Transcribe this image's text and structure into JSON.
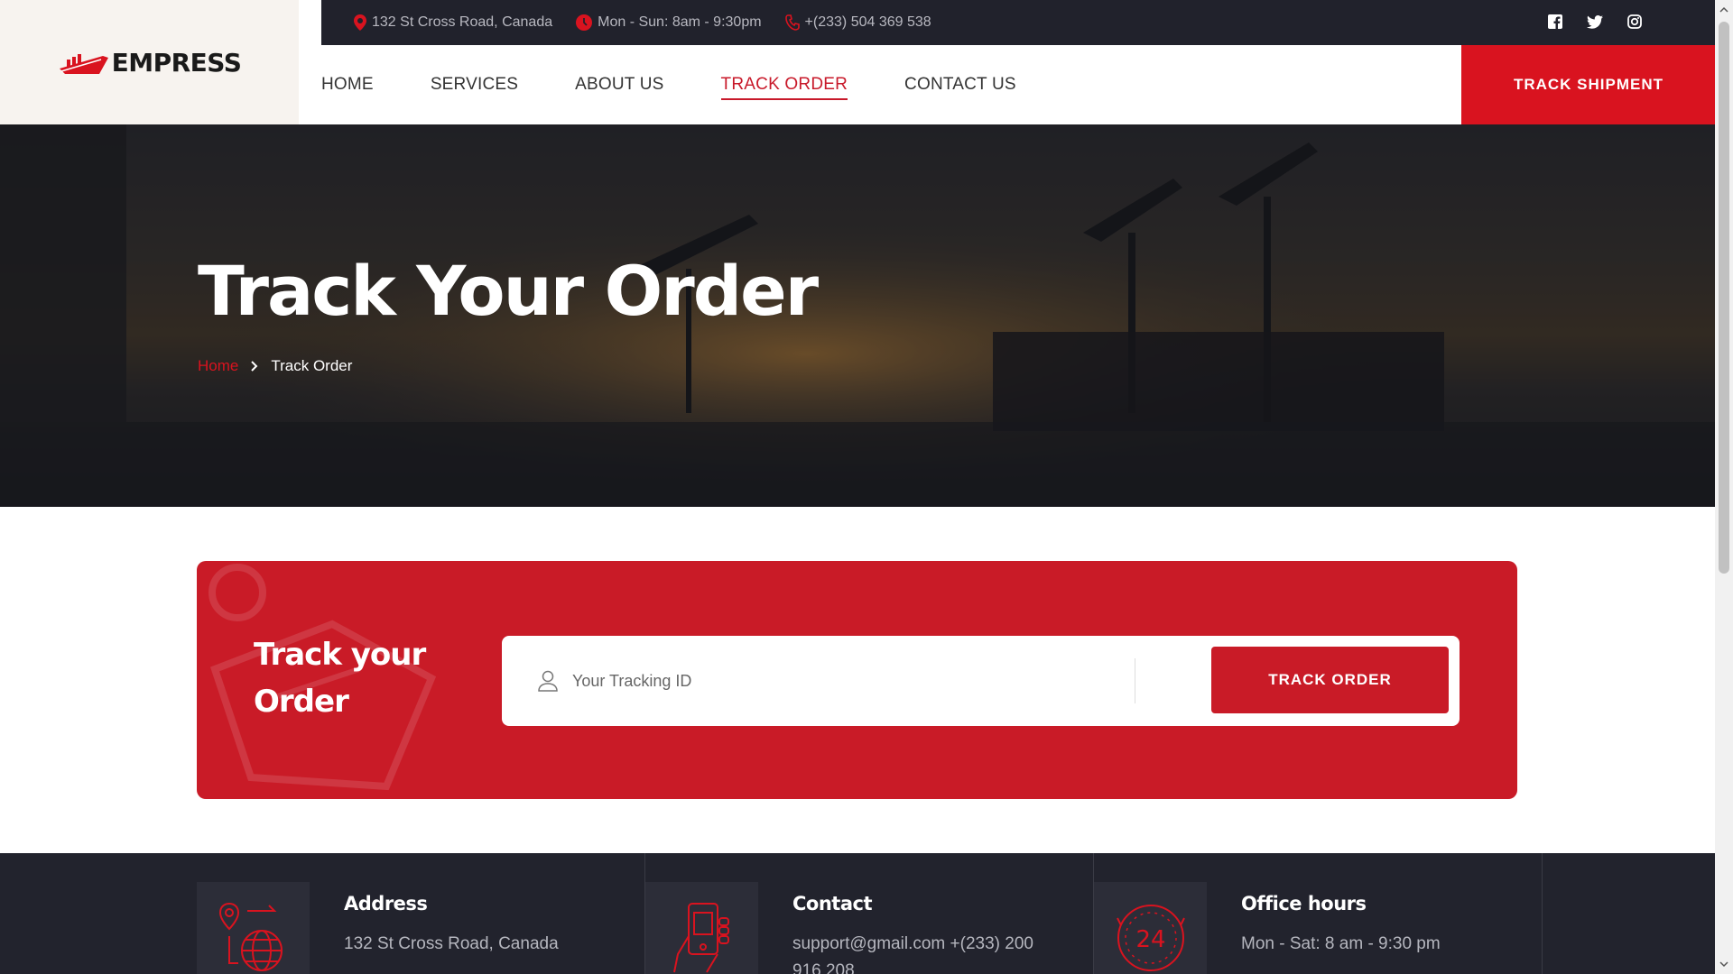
{
  "brand": {
    "name": "EMPRESS"
  },
  "topbar": {
    "address": "132 St Cross Road, Canada",
    "hours": "Mon - Sun: 8am - 9:30pm",
    "phone": "+(233) 504 369 538"
  },
  "nav": {
    "items": [
      "HOME",
      "SERVICES",
      "ABOUT US",
      "TRACK ORDER",
      "CONTACT US"
    ],
    "active": "TRACK ORDER",
    "cta_label": "TRACK SHIPMENT"
  },
  "hero": {
    "title": "Track Your Order",
    "breadcrumb_home": "Home",
    "breadcrumb_current": "Track Order"
  },
  "track_form": {
    "title": "Track your Order",
    "input_placeholder": "Your Tracking ID",
    "input_value": "",
    "button_label": "TRACK ORDER"
  },
  "info": [
    {
      "heading": "Address",
      "text": "132 St Cross Road, Canada",
      "icon": "location-globe-icon"
    },
    {
      "heading": "Contact",
      "text": "support@gmail.com +(233) 200 916 208",
      "icon": "phone-hand-icon"
    },
    {
      "heading": "Office hours",
      "text": "Mon - Sat: 8 am - 9:30 pm",
      "icon": "clock-24-icon"
    }
  ],
  "colors": {
    "accent": "#d9131f",
    "dark": "#21222c",
    "card_red": "#c91b27"
  }
}
